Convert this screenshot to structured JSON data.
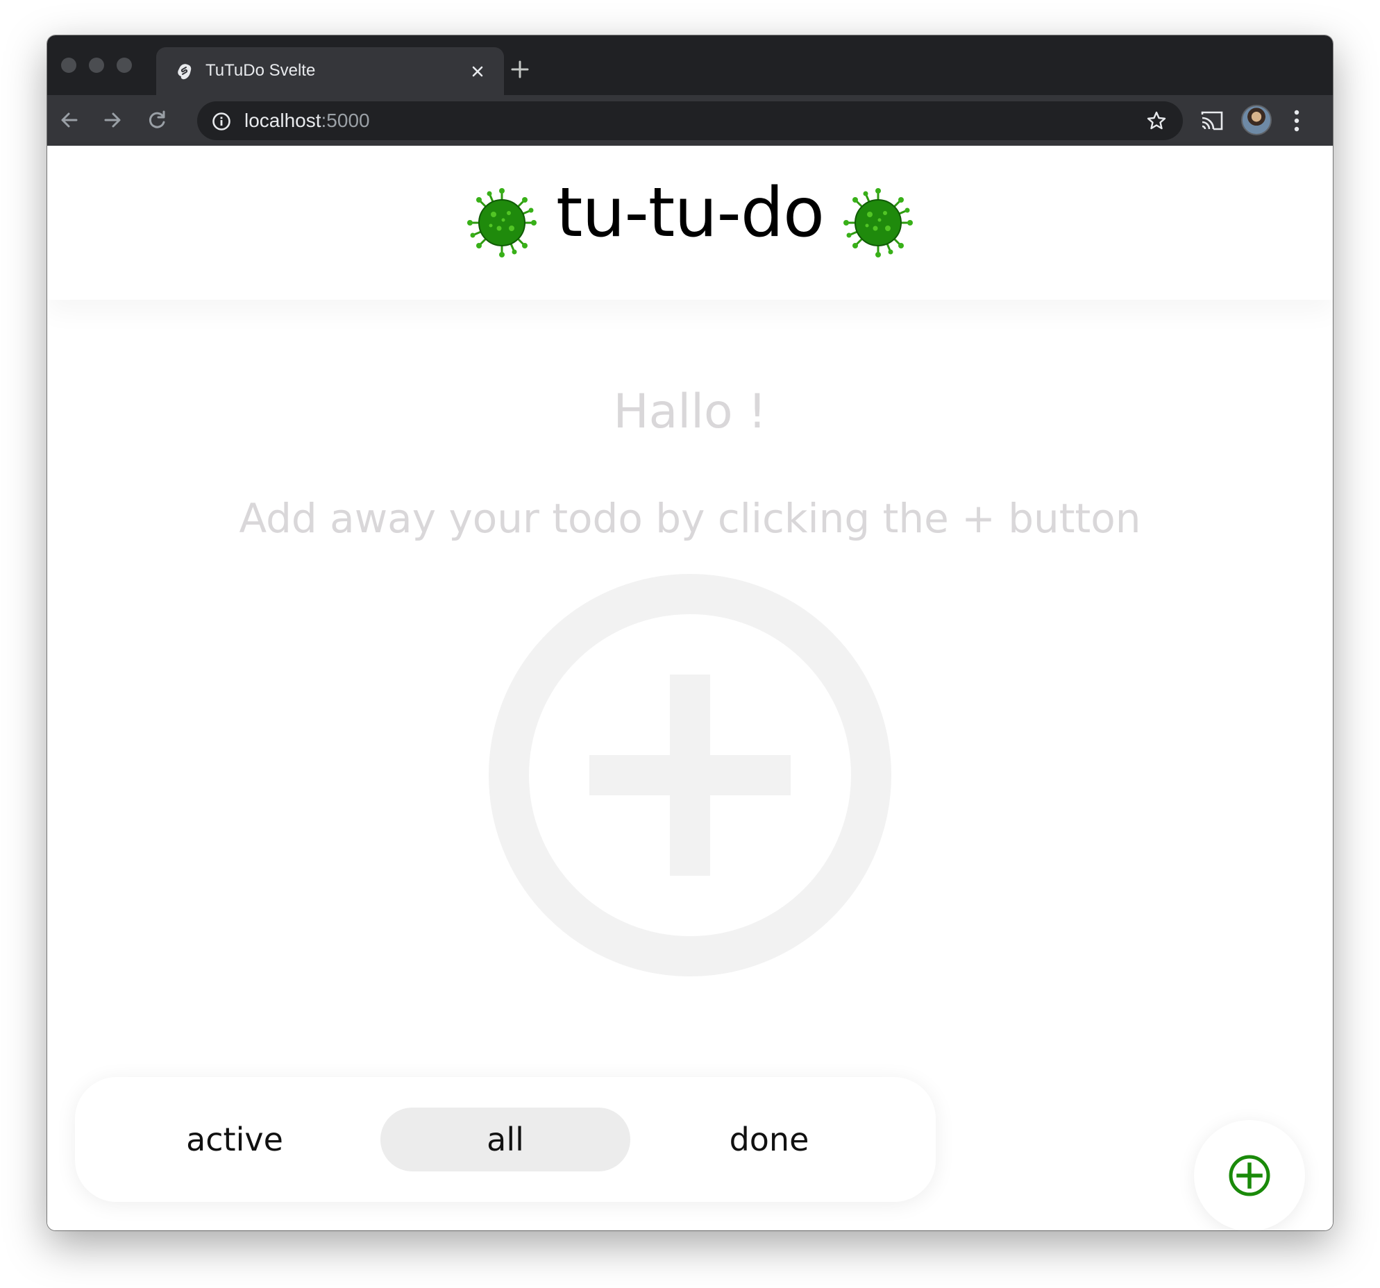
{
  "browser": {
    "tab_title": "TuTuDo Svelte",
    "url_host": "localhost",
    "url_port": ":5000"
  },
  "app": {
    "title": "tu-tu-do",
    "greeting": "Hallo !",
    "hint": "Add away your todo by clicking the + button",
    "accent_color": "#1a8a0a",
    "empty_illustration_color": "#f2f2f2"
  },
  "filters": {
    "items": [
      {
        "label": "active"
      },
      {
        "label": "all"
      },
      {
        "label": "done"
      }
    ],
    "selected": "all"
  },
  "icons": {
    "header_left": "virus-icon",
    "header_right": "virus-icon",
    "empty_state": "add-circle-icon",
    "fab": "add-circle-icon"
  }
}
